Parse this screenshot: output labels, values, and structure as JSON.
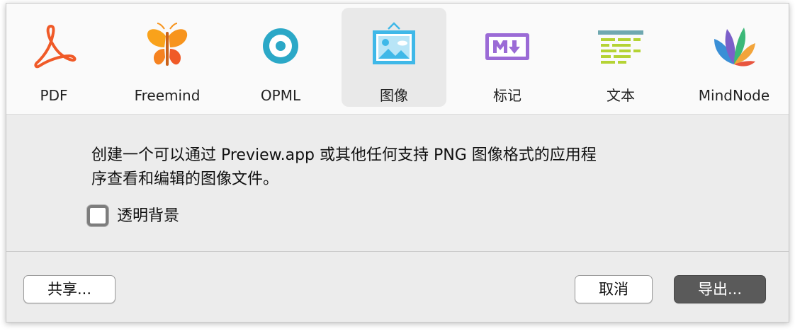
{
  "formats": [
    {
      "label": "PDF",
      "icon": "pdf-icon",
      "selected": false
    },
    {
      "label": "Freemind",
      "icon": "butterfly-icon",
      "selected": false
    },
    {
      "label": "OPML",
      "icon": "opml-icon",
      "selected": false
    },
    {
      "label": "图像",
      "icon": "image-icon",
      "selected": true
    },
    {
      "label": "标记",
      "icon": "markdown-icon",
      "selected": false
    },
    {
      "label": "文本",
      "icon": "text-icon",
      "selected": false
    },
    {
      "label": "MindNode",
      "icon": "mindnode-icon",
      "selected": false
    }
  ],
  "description": {
    "line1": "创建一个可以通过 Preview.app 或其他任何支持 PNG 图像格式的应用程",
    "line2": "序查看和编辑的图像文件。"
  },
  "transparent_background": {
    "label": "透明背景",
    "checked": false
  },
  "buttons": {
    "share": "共享...",
    "cancel": "取消",
    "export": "导出..."
  },
  "colors": {
    "pdf": "#f05a28",
    "butterfly": "#f7941d",
    "opml": "#2ba8c7",
    "image": "#3fb8e8",
    "markdown": "#9b6bd6",
    "text_top": "#6fa8b0",
    "text_lines": "#b5d334",
    "primary_button": "#5a5a5a"
  }
}
